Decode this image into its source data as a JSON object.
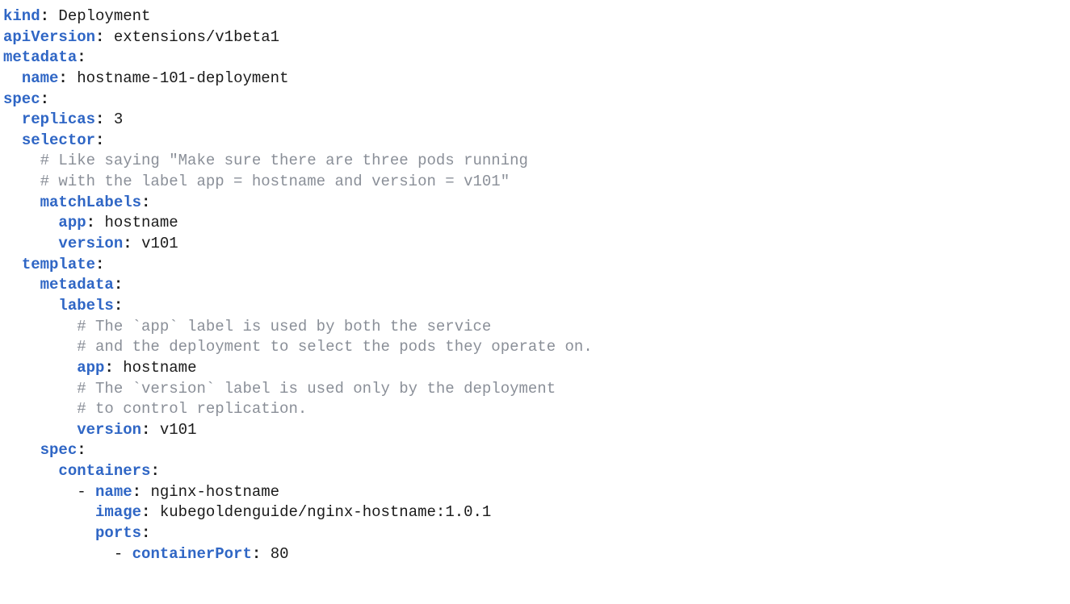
{
  "tokens": {
    "kind_key": "kind",
    "kind_val": "Deployment",
    "apiVersion_key": "apiVersion",
    "apiVersion_val": "extensions/v1beta1",
    "metadata_key": "metadata",
    "metadata_name_key": "name",
    "metadata_name_val": "hostname-101-deployment",
    "spec_key": "spec",
    "replicas_key": "replicas",
    "replicas_val": "3",
    "selector_key": "selector",
    "cmt_selector_1": "# Like saying \"Make sure there are three pods running",
    "cmt_selector_2": "# with the label app = hostname and version = v101\"",
    "matchLabels_key": "matchLabels",
    "match_app_key": "app",
    "match_app_val": "hostname",
    "match_version_key": "version",
    "match_version_val": "v101",
    "template_key": "template",
    "tpl_metadata_key": "metadata",
    "tpl_labels_key": "labels",
    "cmt_labels_1": "# The `app` label is used by both the service",
    "cmt_labels_2": "# and the deployment to select the pods they operate on.",
    "tpl_app_key": "app",
    "tpl_app_val": "hostname",
    "cmt_labels_3": "# The `version` label is used only by the deployment",
    "cmt_labels_4": "# to control replication.",
    "tpl_version_key": "version",
    "tpl_version_val": "v101",
    "tpl_spec_key": "spec",
    "containers_key": "containers",
    "cnt_name_key": "name",
    "cnt_name_val": "nginx-hostname",
    "cnt_image_key": "image",
    "cnt_image_val": "kubegoldenguide/nginx-hostname:1.0.1",
    "cnt_ports_key": "ports",
    "containerPort_key": "containerPort",
    "containerPort_val": "80",
    "colon": ":",
    "colon_sp": ": ",
    "dash_sp": "- "
  }
}
